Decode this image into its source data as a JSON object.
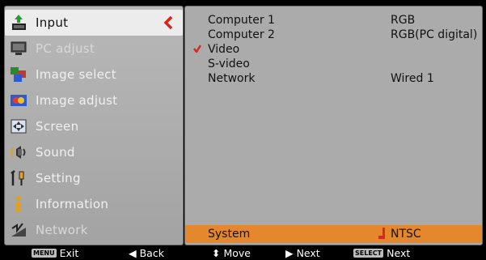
{
  "menu": {
    "items": [
      {
        "label": "Input",
        "icon": "input-icon",
        "state": "active"
      },
      {
        "label": "PC adjust",
        "icon": "pc-adjust-icon",
        "state": "dim"
      },
      {
        "label": "Image select",
        "icon": "image-select-icon",
        "state": "normal"
      },
      {
        "label": "Image adjust",
        "icon": "image-adjust-icon",
        "state": "normal"
      },
      {
        "label": "Screen",
        "icon": "screen-icon",
        "state": "normal"
      },
      {
        "label": "Sound",
        "icon": "sound-icon",
        "state": "normal"
      },
      {
        "label": "Setting",
        "icon": "setting-icon",
        "state": "normal"
      },
      {
        "label": "Information",
        "icon": "information-icon",
        "state": "normal"
      },
      {
        "label": "Network",
        "icon": "network-icon",
        "state": "dim"
      }
    ]
  },
  "panel": {
    "rows": [
      {
        "name": "Computer 1",
        "value": "RGB",
        "checked": false
      },
      {
        "name": "Computer 2",
        "value": "RGB(PC digital)",
        "checked": false
      },
      {
        "name": "Video",
        "value": "",
        "checked": true
      },
      {
        "name": "S-video",
        "value": "",
        "checked": false
      },
      {
        "name": "Network",
        "value": "Wired 1",
        "checked": false
      }
    ],
    "system_row": {
      "name": "System",
      "value": "NTSC"
    }
  },
  "help": {
    "exit_key": "MENU",
    "exit": "Exit",
    "back": "◀ Back",
    "move": "⬍ Move",
    "next": "▶ Next",
    "select_key": "SELECT",
    "select_next": "Next"
  },
  "colors": {
    "accent": "#e4872d",
    "check": "#d42a20",
    "chevron": "#e0201a"
  }
}
